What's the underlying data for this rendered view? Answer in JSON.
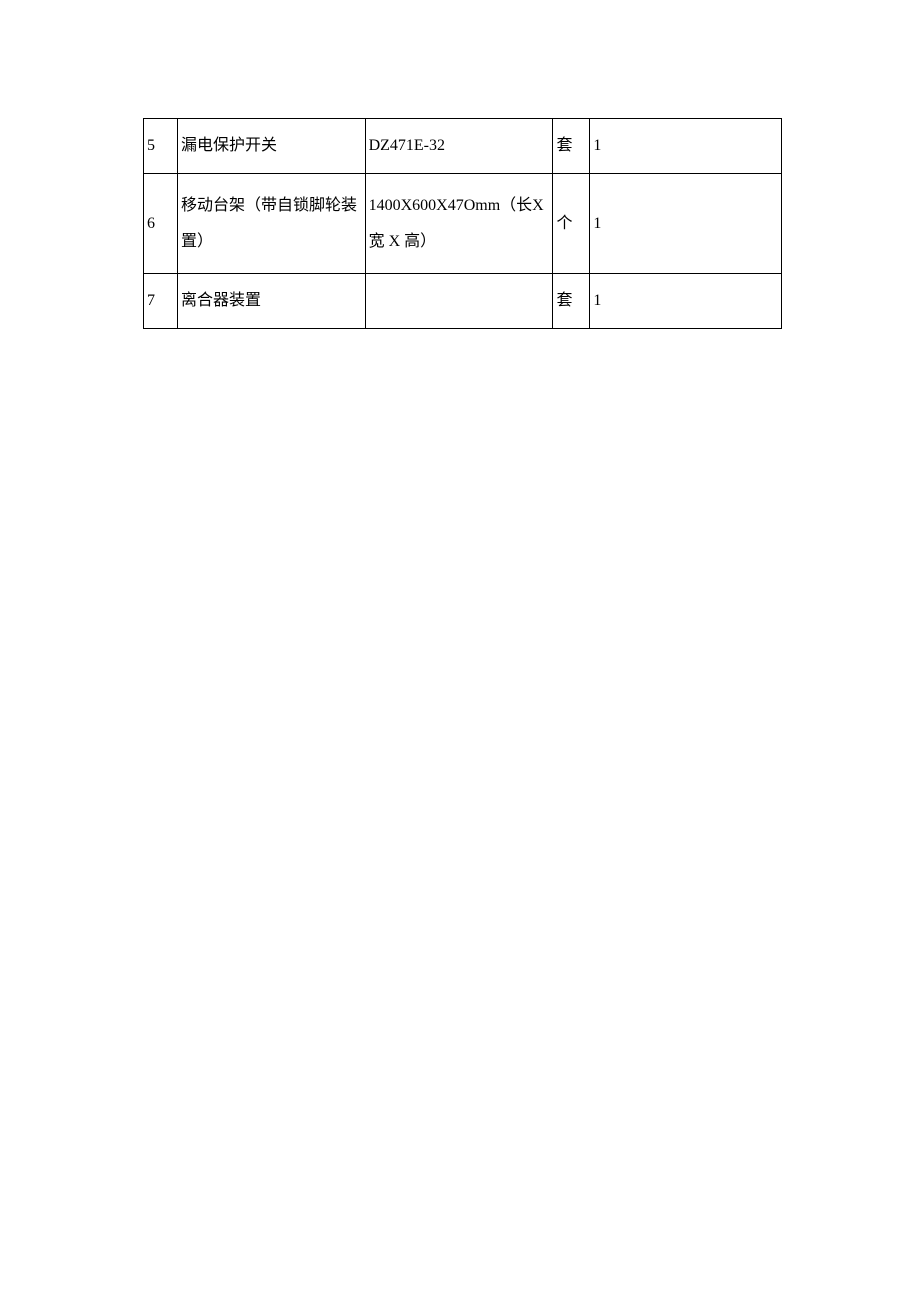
{
  "table": {
    "rows": [
      {
        "index": "5",
        "name": "漏电保护开关",
        "spec": "DZ471E-32",
        "unit": "套",
        "qty": "1"
      },
      {
        "index": "6",
        "name": "移动台架（带自锁脚轮装置）",
        "spec": "1400X600X47Omm（长X 宽 X 高）",
        "unit": "个",
        "qty": "1"
      },
      {
        "index": "7",
        "name": "离合器装置",
        "spec": "",
        "unit": "套",
        "qty": "1"
      }
    ]
  }
}
